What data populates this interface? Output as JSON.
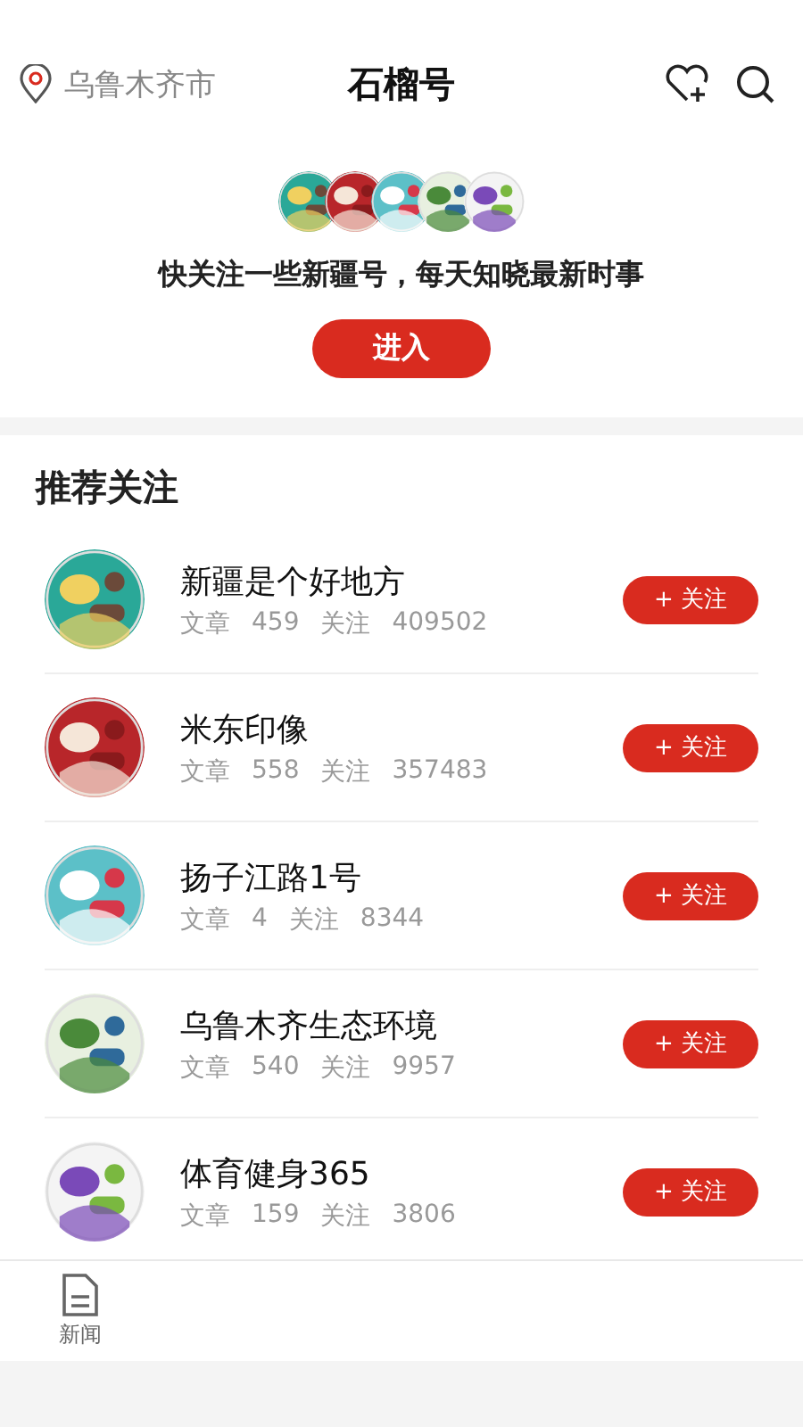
{
  "header": {
    "location": "乌鲁木齐市",
    "title": "石榴号"
  },
  "banner": {
    "message": "快关注一些新疆号，每天知晓最新时事",
    "button": "进入"
  },
  "recommend": {
    "title": "推荐关注",
    "accounts": [
      {
        "name": "新疆是个好地方",
        "articles_label": "文章",
        "articles": "459",
        "followers_label": "关注",
        "followers": "409502",
        "follow": "+ 关注"
      },
      {
        "name": "米东印像",
        "articles_label": "文章",
        "articles": "558",
        "followers_label": "关注",
        "followers": "357483",
        "follow": "+ 关注"
      },
      {
        "name": "扬子江路1号",
        "articles_label": "文章",
        "articles": "4",
        "followers_label": "关注",
        "followers": "8344",
        "follow": "+ 关注"
      },
      {
        "name": "乌鲁木齐生态环境",
        "articles_label": "文章",
        "articles": "540",
        "followers_label": "关注",
        "followers": "9957",
        "follow": "+ 关注"
      },
      {
        "name": "体育健身365",
        "articles_label": "文章",
        "articles": "159",
        "followers_label": "关注",
        "followers": "3806",
        "follow": "+ 关注"
      }
    ]
  },
  "tab_bar": {
    "tabs": [
      {
        "label": "新闻"
      }
    ]
  }
}
